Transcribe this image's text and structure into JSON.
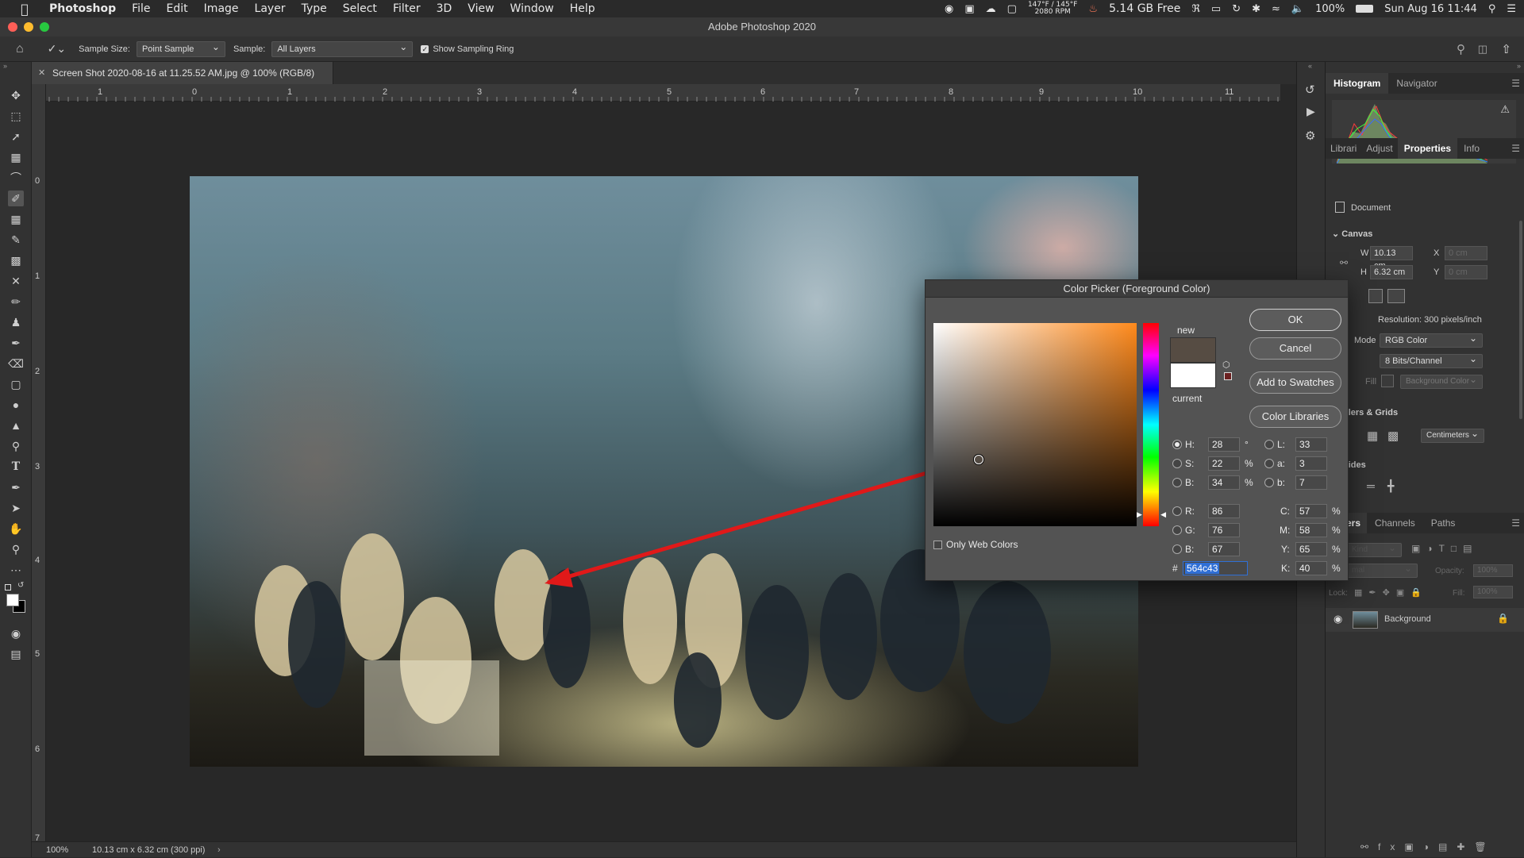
{
  "menubar": {
    "app": "Photoshop",
    "items": [
      "File",
      "Edit",
      "Image",
      "Layer",
      "Type",
      "Select",
      "Filter",
      "3D",
      "View",
      "Window",
      "Help"
    ],
    "temp_top": "147°F / 145°F",
    "temp_bottom": "2080 RPM",
    "disk": "5.14 GB Free",
    "battery": "100%",
    "datetime": "Sun Aug 16  11:44"
  },
  "window": {
    "title": "Adobe Photoshop 2020"
  },
  "options": {
    "sample_size_label": "Sample Size:",
    "sample_size_value": "Point Sample",
    "sample_label": "Sample:",
    "sample_value": "All Layers",
    "ring_label": "Show Sampling Ring"
  },
  "document": {
    "tab_title": "Screen Shot 2020-08-16 at 11.25.52 AM.jpg @ 100% (RGB/8)",
    "ruler_h": [
      "1",
      "0",
      "1",
      "2",
      "3",
      "4",
      "5",
      "6",
      "7",
      "8",
      "9",
      "10",
      "11"
    ],
    "ruler_v": [
      "0",
      "1",
      "2",
      "3",
      "4",
      "5",
      "6",
      "7"
    ],
    "zoom": "100%",
    "size_info": "10.13 cm x 6.32 cm (300 ppi)"
  },
  "panels": {
    "top_tabs": [
      "Histogram",
      "Navigator"
    ],
    "mid_tabs": [
      "Librari",
      "Adjust",
      "Properties",
      "Info"
    ],
    "document_label": "Document",
    "canvas_label": "Canvas",
    "w_label": "W",
    "w_value": "10.13 cm",
    "h_label": "H",
    "h_value": "6.32 cm",
    "x_label": "X",
    "x_placeholder": "0 cm",
    "y_label": "Y",
    "y_placeholder": "0 cm",
    "resolution": "Resolution: 300 pixels/inch",
    "mode_label": "Mode",
    "mode_value": "RGB Color",
    "bits_value": "8 Bits/Channel",
    "fill_label": "Fill",
    "fill_value": "Background Color",
    "rulers_label": "ulers & Grids",
    "units_value": "Centimeters",
    "guides_label": "uides",
    "layer_tabs": [
      "ers",
      "Channels",
      "Paths"
    ],
    "kind_placeholder": "Kind",
    "blend_placeholder": "mal",
    "opacity_label": "Opacity:",
    "opacity_value": "100%",
    "lock_label": "Lock:",
    "fill2_label": "Fill:",
    "fill2_value": "100%",
    "layer_name": "Background"
  },
  "color_picker": {
    "title": "Color Picker (Foreground Color)",
    "ok": "OK",
    "cancel": "Cancel",
    "add_swatches": "Add to Swatches",
    "libraries": "Color Libraries",
    "new_label": "new",
    "current_label": "current",
    "only_web": "Only Web Colors",
    "fields": {
      "H": "28",
      "S": "22",
      "B": "34",
      "R": "86",
      "G": "76",
      "B2": "67",
      "L": "33",
      "a": "3",
      "b": "7",
      "C": "57",
      "M": "58",
      "Y": "65",
      "K": "40"
    },
    "units": {
      "deg": "°",
      "pct": "%"
    },
    "hex_label": "#",
    "hex": "564c43",
    "new_color": "#564c43",
    "current_color": "#ffffff"
  }
}
